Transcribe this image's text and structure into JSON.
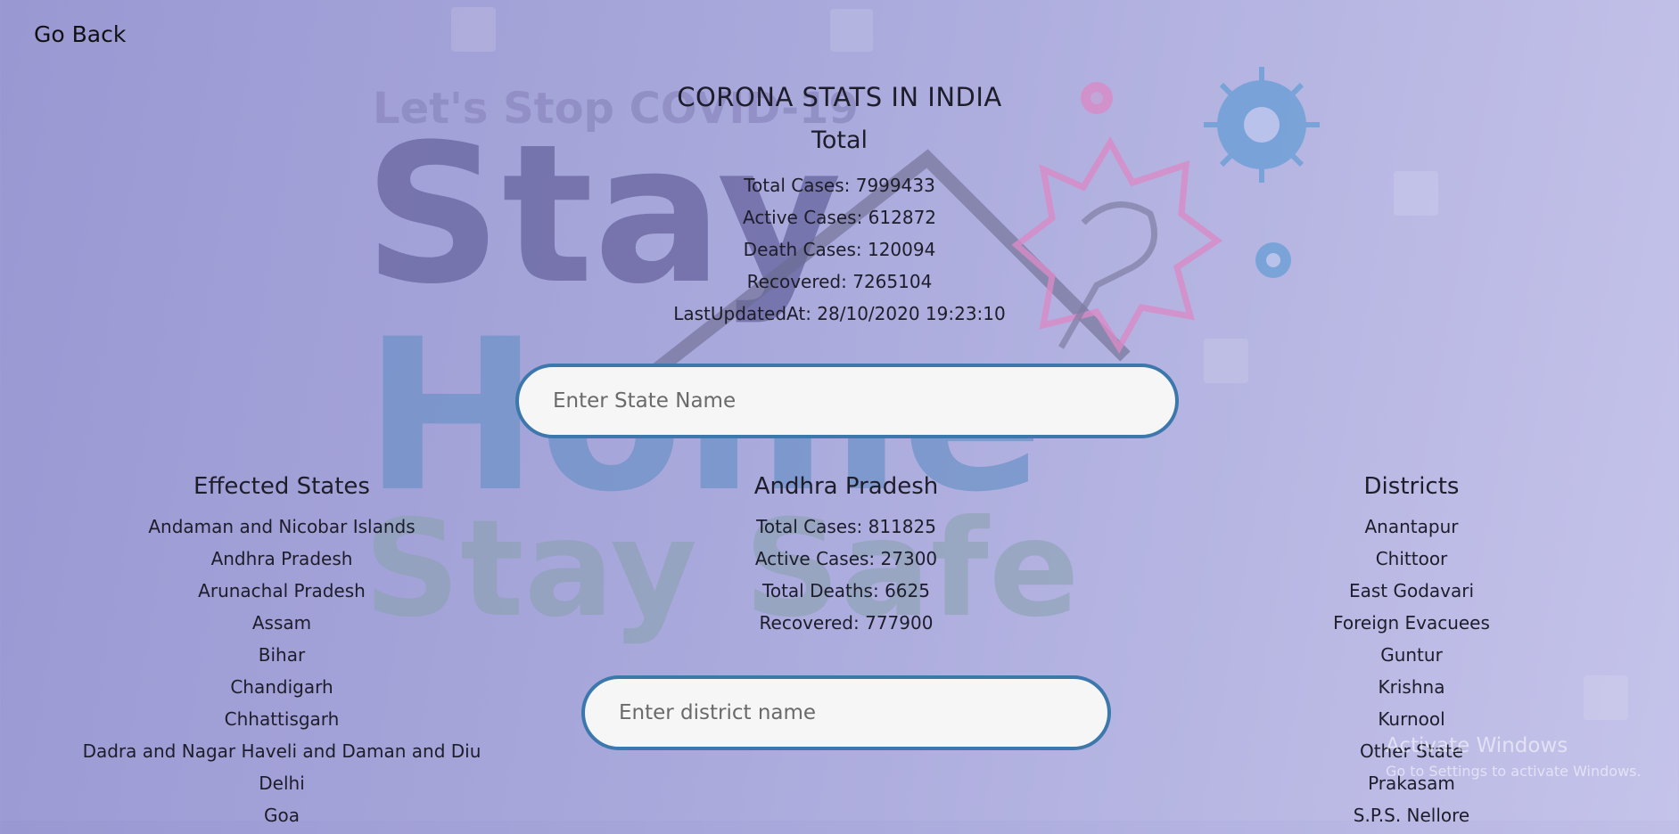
{
  "nav": {
    "go_back_label": "Go Back"
  },
  "page": {
    "title": "CORONA STATS IN INDIA"
  },
  "total": {
    "heading": "Total",
    "stats": [
      "Total Cases: 7999433",
      "Active Cases: 612872",
      "Death Cases: 120094",
      "Recovered: 7265104",
      "LastUpdatedAt: 28/10/2020 19:23:10"
    ]
  },
  "state_search": {
    "placeholder": "Enter State Name",
    "value": ""
  },
  "district_search": {
    "placeholder": "Enter district name",
    "value": ""
  },
  "states": {
    "heading": "Effected States",
    "items": [
      "Andaman and Nicobar Islands",
      "Andhra Pradesh",
      "Arunachal Pradesh",
      "Assam",
      "Bihar",
      "Chandigarh",
      "Chhattisgarh",
      "Dadra and Nagar Haveli and Daman and Diu",
      "Delhi",
      "Goa"
    ]
  },
  "selected_state": {
    "name": "Andhra Pradesh",
    "stats": [
      "Total Cases: 811825",
      "Active Cases: 27300",
      "Total Deaths: 6625",
      "Recovered: 777900"
    ]
  },
  "districts": {
    "heading": "Districts",
    "items": [
      "Anantapur",
      "Chittoor",
      "East Godavari",
      "Foreign Evacuees",
      "Guntur",
      "Krishna",
      "Kurnool",
      "Other State",
      "Prakasam",
      "S.P.S. Nellore"
    ]
  },
  "background": {
    "poster_lines": [
      "Let's Stop COVID-19",
      "Stay",
      "Home",
      "Stay Safe"
    ],
    "colors": {
      "stay": "#6f6ca6",
      "home": "#6f93c8",
      "stay_safe": "#8aa2b0",
      "virus": "#6b9fd6",
      "burst": "#d98ac6"
    }
  },
  "os_overlay": {
    "title": "Activate Windows",
    "subtitle": "Go to Settings to activate Windows."
  },
  "colors": {
    "input_border": "#3d78ad",
    "input_bg": "#f6f6f6"
  }
}
